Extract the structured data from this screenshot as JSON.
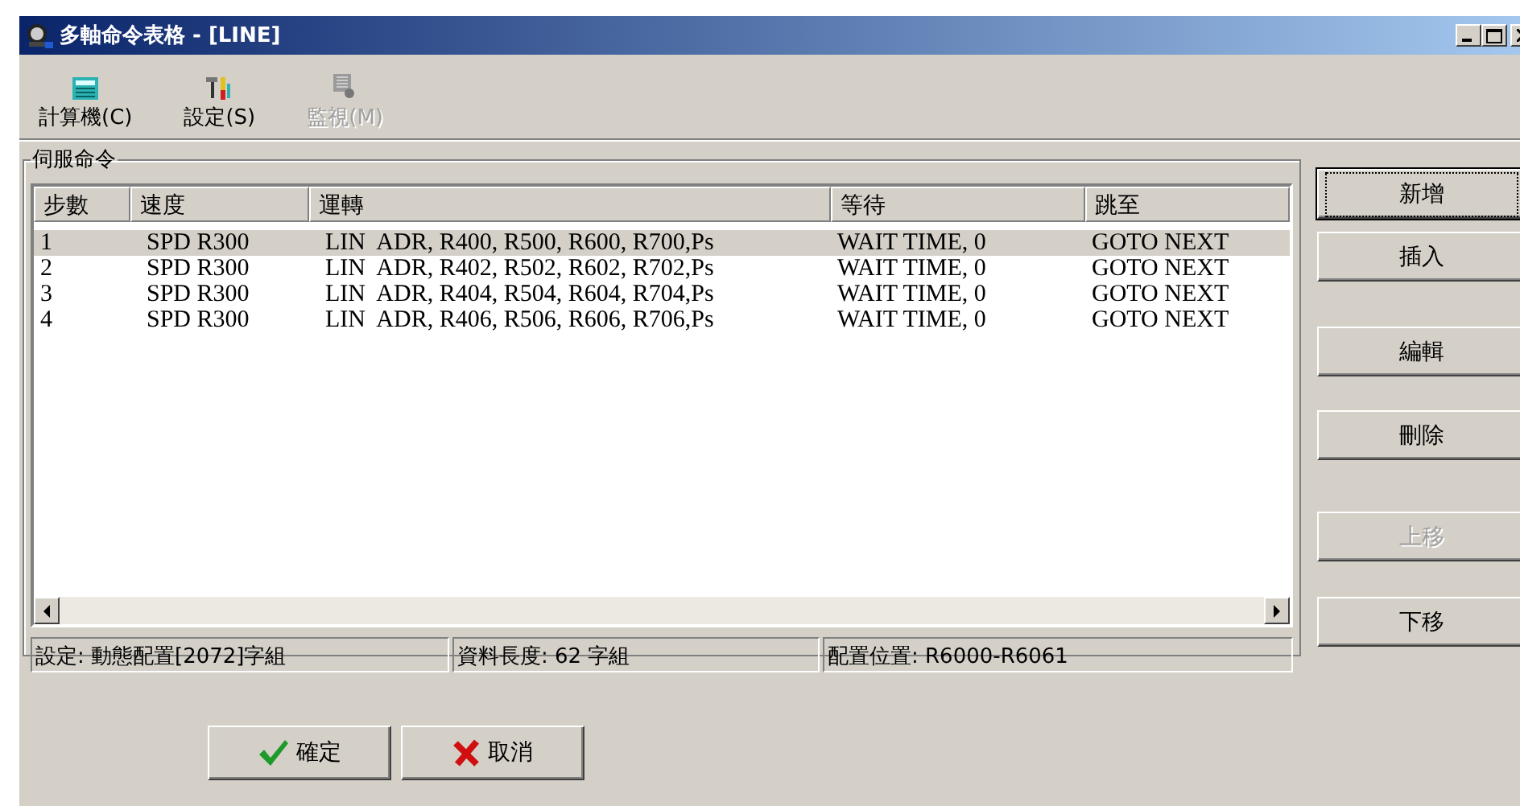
{
  "window": {
    "title": "多軸命令表格 - [LINE]"
  },
  "toolbar": [
    {
      "label": "計算機(C)",
      "kind": "calculator",
      "disabled": false
    },
    {
      "label": "設定(S)",
      "kind": "tools",
      "disabled": false
    },
    {
      "label": "監視(M)",
      "kind": "monitor",
      "disabled": true
    }
  ],
  "group": {
    "title": "伺服命令"
  },
  "table": {
    "columns": [
      "步數",
      "速度",
      "運轉",
      "等待",
      "跳至"
    ],
    "rows": [
      {
        "cells": [
          "1",
          "SPD R300",
          "LIN  ADR, R400, R500, R600, R700,Ps",
          "WAIT TIME, 0",
          "GOTO NEXT"
        ],
        "selected": true
      },
      {
        "cells": [
          "2",
          "SPD R300",
          "LIN  ADR, R402, R502, R602, R702,Ps",
          "WAIT TIME, 0",
          "GOTO NEXT"
        ],
        "selected": false
      },
      {
        "cells": [
          "3",
          "SPD R300",
          "LIN  ADR, R404, R504, R604, R704,Ps",
          "WAIT TIME, 0",
          "GOTO NEXT"
        ],
        "selected": false
      },
      {
        "cells": [
          "4",
          "SPD R300",
          "LIN  ADR, R406, R506, R606, R706,Ps",
          "WAIT TIME, 0",
          "GOTO NEXT"
        ],
        "selected": false
      }
    ]
  },
  "status_bar": [
    "設定: 動態配置[2072]字組",
    "資料長度: 62 字組",
    "配置位置: R6000-R6061"
  ],
  "side_buttons": [
    {
      "label": "新增",
      "disabled": false,
      "focused": true
    },
    {
      "label": "插入",
      "disabled": false,
      "focused": false
    },
    {
      "label": "編輯",
      "disabled": false,
      "focused": false
    },
    {
      "label": "刪除",
      "disabled": false,
      "focused": false
    },
    {
      "label": "上移",
      "disabled": true,
      "focused": false
    },
    {
      "label": "下移",
      "disabled": false,
      "focused": false
    }
  ],
  "dialog_buttons": [
    {
      "label": "確定",
      "kind": "ok"
    },
    {
      "label": "取消",
      "kind": "cancel"
    }
  ]
}
